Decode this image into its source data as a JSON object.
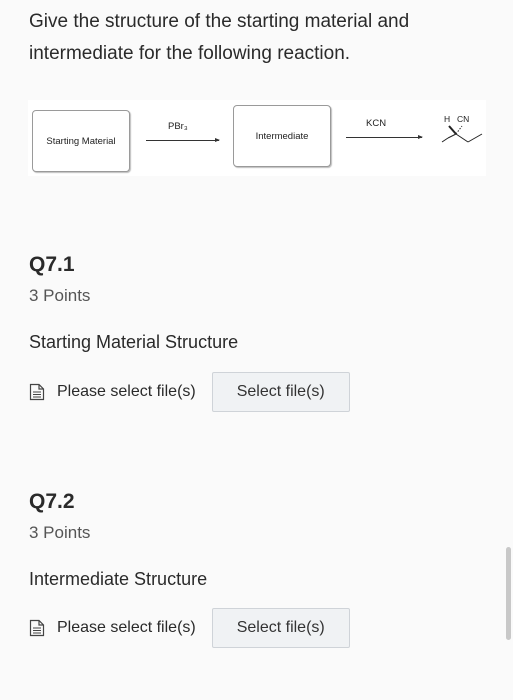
{
  "question": {
    "prompt": "Give the structure of the starting material and intermediate for the following reaction."
  },
  "scheme": {
    "starting_material_label": "Starting Material",
    "reagent_1": "PBr₃",
    "intermediate_label": "Intermediate",
    "reagent_2": "KCN",
    "product_h": "H",
    "product_cn": "CN"
  },
  "subquestions": [
    {
      "title": "Q7.1",
      "points": "3 Points",
      "subtitle": "Starting Material Structure",
      "file_label": "Please select file(s)",
      "button_label": "Select file(s)"
    },
    {
      "title": "Q7.2",
      "points": "3 Points",
      "subtitle": "Intermediate Structure",
      "file_label": "Please select file(s)",
      "button_label": "Select file(s)"
    }
  ],
  "icons": {
    "file": "file-icon"
  }
}
